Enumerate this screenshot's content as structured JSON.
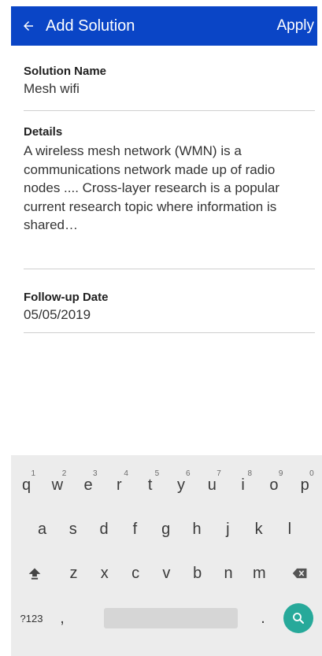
{
  "appbar": {
    "title": "Add Solution",
    "action": "Apply"
  },
  "fields": {
    "name": {
      "label": "Solution Name",
      "value": "Mesh wifi"
    },
    "details": {
      "label": "Details",
      "value": "A wireless mesh network (WMN) is a communications network made up of radio nodes .... Cross-layer research is a popular current research topic where information is shared…"
    },
    "followup": {
      "label": "Follow-up Date",
      "value": "05/05/2019"
    }
  },
  "keyboard": {
    "row1": [
      {
        "key": "q",
        "num": "1"
      },
      {
        "key": "w",
        "num": "2"
      },
      {
        "key": "e",
        "num": "3"
      },
      {
        "key": "r",
        "num": "4"
      },
      {
        "key": "t",
        "num": "5"
      },
      {
        "key": "y",
        "num": "6"
      },
      {
        "key": "u",
        "num": "7"
      },
      {
        "key": "i",
        "num": "8"
      },
      {
        "key": "o",
        "num": "9"
      },
      {
        "key": "p",
        "num": "0"
      }
    ],
    "row2": [
      "a",
      "s",
      "d",
      "f",
      "g",
      "h",
      "j",
      "k",
      "l"
    ],
    "row3": [
      "z",
      "x",
      "c",
      "v",
      "b",
      "n",
      "m"
    ],
    "row4": {
      "symbols": "?123",
      "comma": ",",
      "period": "."
    },
    "colors": {
      "accent": "#0a45c6",
      "go": "#27a99a"
    }
  }
}
